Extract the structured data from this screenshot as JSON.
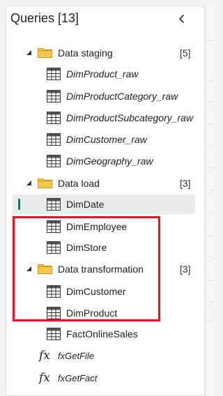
{
  "panel": {
    "title": "Queries [13]",
    "collapse_icon": "chevron-left-icon"
  },
  "groups": [
    {
      "name": "Data staging",
      "count": "[5]",
      "expanded": true
    },
    {
      "name": "Data load",
      "count": "[3]",
      "expanded": true
    },
    {
      "name": "Data transformation",
      "count": "[3]",
      "expanded": true
    }
  ],
  "queries": [
    {
      "name": "DimProduct_raw",
      "icon": "table-icon",
      "italic": true
    },
    {
      "name": "DimProductCategory_raw",
      "icon": "table-icon",
      "italic": true
    },
    {
      "name": "DimProductSubcategory_raw",
      "icon": "table-icon",
      "italic": true
    },
    {
      "name": "DimCustomer_raw",
      "icon": "table-icon",
      "italic": true
    },
    {
      "name": "DimGeography_raw",
      "icon": "table-icon",
      "italic": true
    },
    {
      "name": "DimDate",
      "icon": "table-icon",
      "italic": false,
      "selected": true
    },
    {
      "name": "DimEmployee",
      "icon": "table-icon",
      "italic": false
    },
    {
      "name": "DimStore",
      "icon": "table-icon",
      "italic": false
    },
    {
      "name": "DimCustomer",
      "icon": "table-icon",
      "italic": false
    },
    {
      "name": "DimProduct",
      "icon": "table-icon",
      "italic": false
    },
    {
      "name": "FactOnlineSales",
      "icon": "table-icon",
      "italic": false
    }
  ],
  "functions": [
    {
      "name": "fxGetFile",
      "icon": "fx-icon",
      "glyph": "fx"
    },
    {
      "name": "fxGetFact",
      "icon": "fx-icon",
      "glyph": "fx"
    }
  ],
  "colors": {
    "accent": "#117865",
    "highlight_border": "#e5161d",
    "folder_fill": "#f7c84b",
    "folder_stroke": "#c9961e"
  }
}
